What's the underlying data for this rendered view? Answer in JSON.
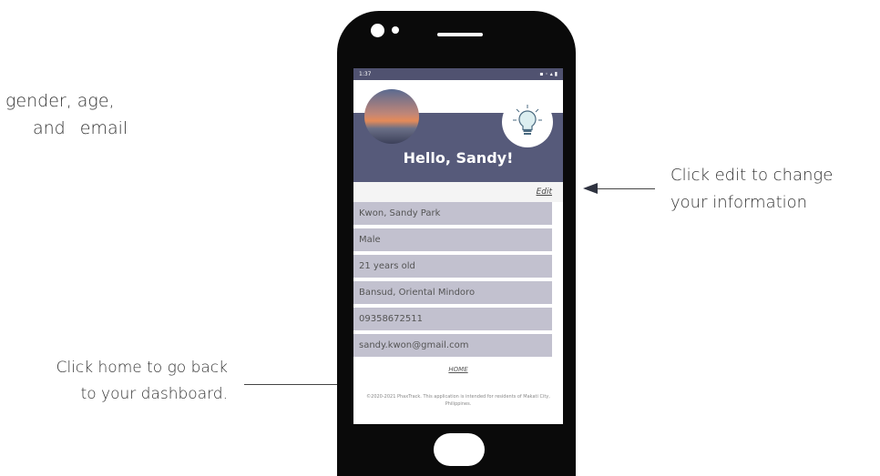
{
  "annotations": {
    "left_top_line1": "gender, age,",
    "left_top_line2": "and email",
    "right_line1": "Click edit to change",
    "right_line2": "your information",
    "bottom_left_line1": "Click home to go back",
    "bottom_left_line2": "to your dashboard."
  },
  "phone": {
    "statusbar": {
      "time": "1:37"
    },
    "header": {
      "greeting": "Hello, Sandy!"
    },
    "edit_label": "Edit",
    "profile": [
      "Kwon, Sandy Park",
      "Male",
      "21 years old",
      "Bansud, Oriental Mindoro",
      "09358672511",
      "sandy.kwon@gmail.com"
    ],
    "home_label": "HOME",
    "footer": "©2020-2021 PhaxTrack. This application is intended for residents of Makati City, Philippines."
  },
  "colors": {
    "band": "#565a7a",
    "row": "#c2c1cf",
    "arrow": "#2f3340"
  }
}
